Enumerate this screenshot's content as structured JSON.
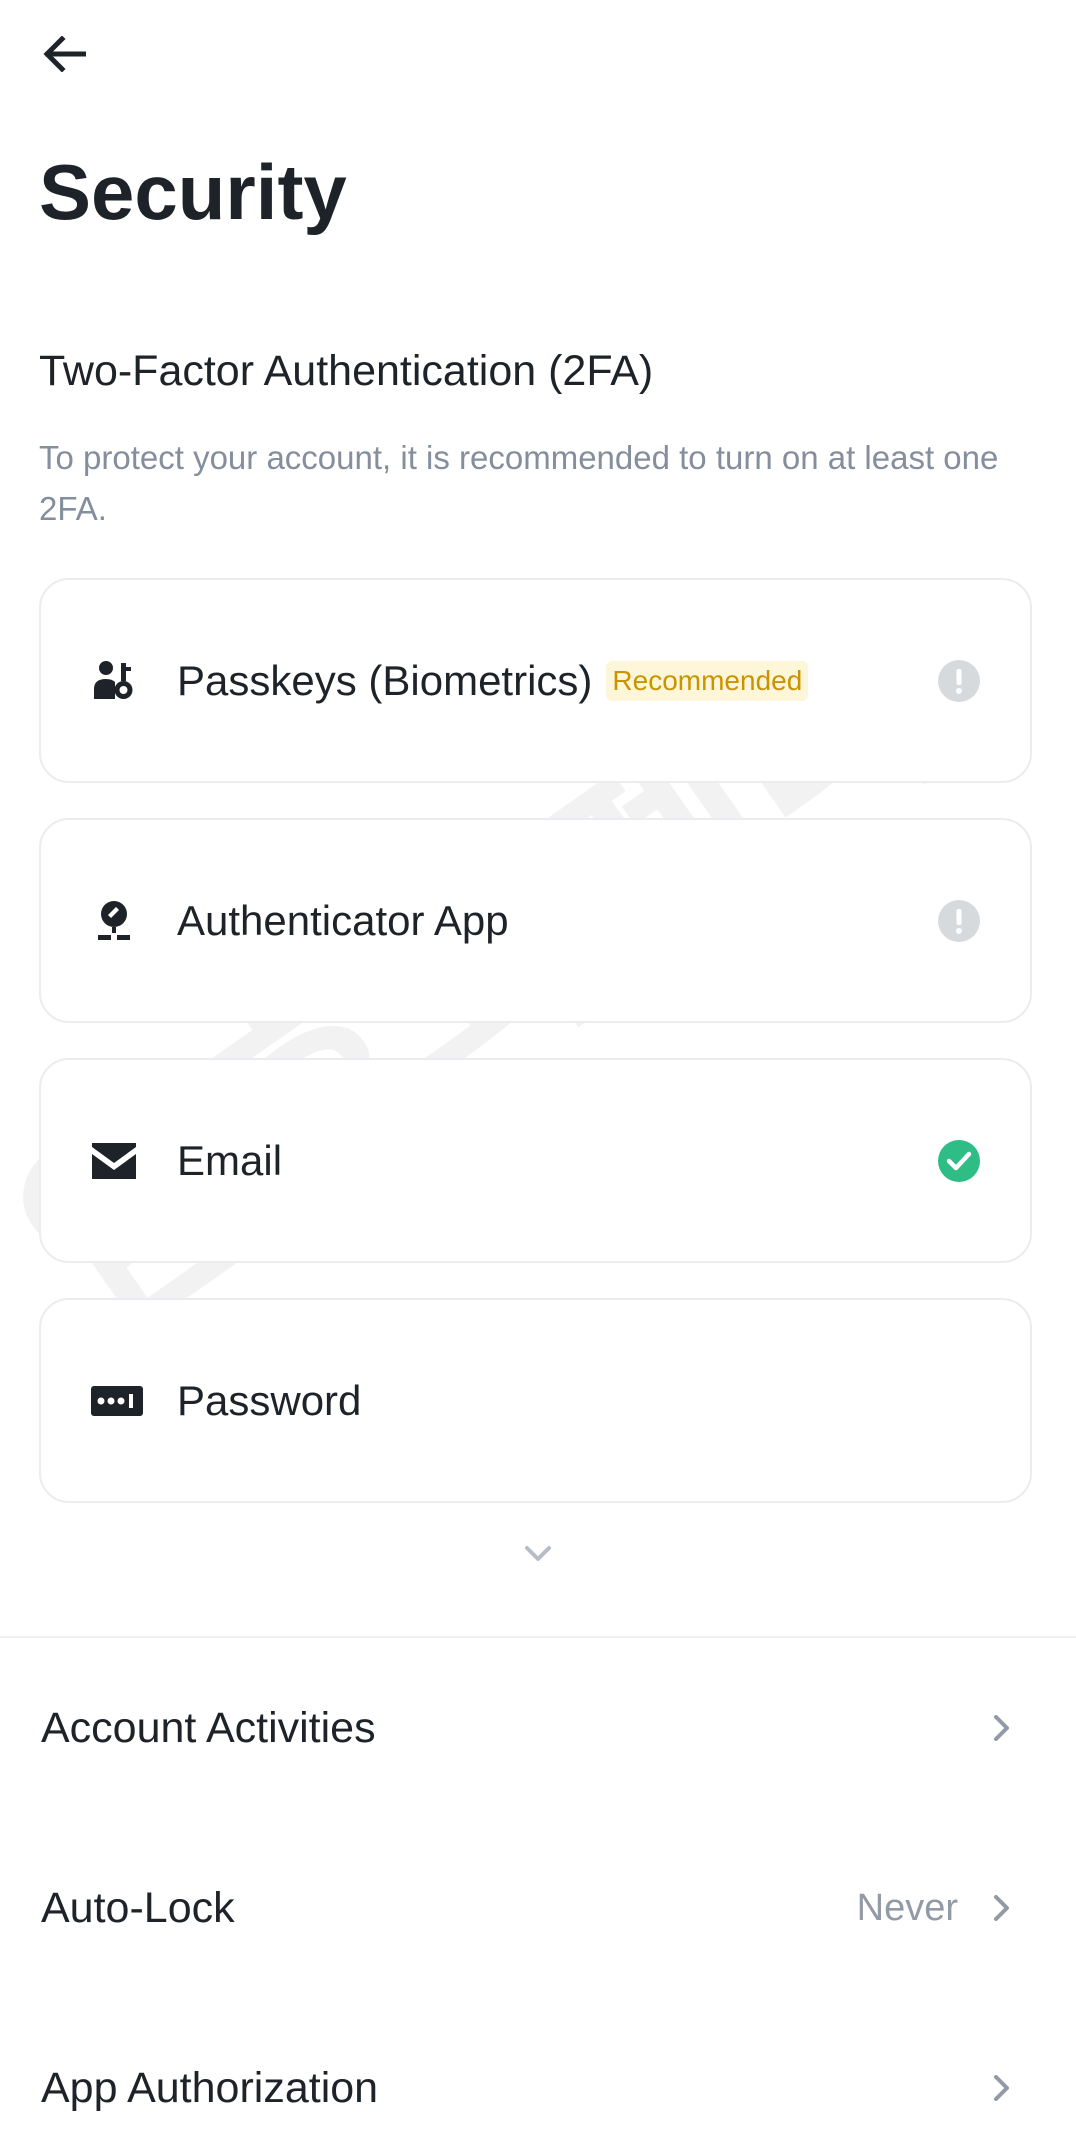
{
  "header": {
    "back_icon": "arrow-left-icon",
    "title": "Security"
  },
  "two_factor": {
    "title": "Two-Factor Authentication (2FA)",
    "description": "To protect your account, it is recommended to turn on at least one 2FA.",
    "methods": [
      {
        "label": "Passkeys (Biometrics)",
        "badge": "Recommended",
        "icon": "passkey-icon",
        "status": "warning",
        "status_icon": "exclamation-icon"
      },
      {
        "label": "Authenticator App",
        "icon": "authenticator-icon",
        "status": "warning",
        "status_icon": "exclamation-icon"
      },
      {
        "label": "Email",
        "icon": "envelope-icon",
        "status": "enabled",
        "status_icon": "check-circle-icon"
      },
      {
        "label": "Password",
        "icon": "password-icon"
      }
    ],
    "expand_icon": "chevron-down-icon"
  },
  "settings": [
    {
      "label": "Account Activities",
      "value": ""
    },
    {
      "label": "Auto-Lock",
      "value": "Never"
    },
    {
      "label": "App Authorization",
      "value": ""
    }
  ],
  "watermark": "암호화폐나이트",
  "colors": {
    "text_primary": "#1e2329",
    "text_secondary": "#848e9c",
    "badge_text": "#c99400",
    "badge_bg": "#fef6d8",
    "warning_icon": "#d7dadd",
    "success": "#2ebd85",
    "border": "#eaecef"
  }
}
